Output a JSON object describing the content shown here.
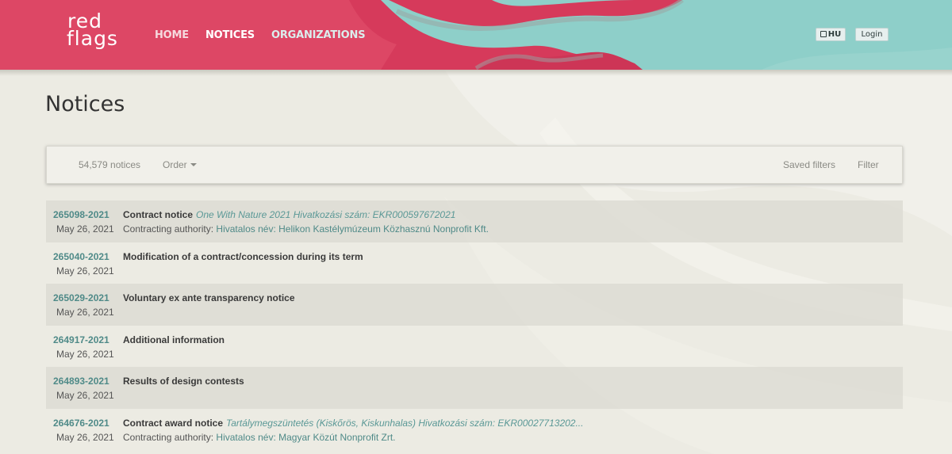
{
  "header": {
    "logo": {
      "line1": "red",
      "line2": "flags"
    },
    "nav": [
      {
        "label": "HOME"
      },
      {
        "label": "NOTICES"
      },
      {
        "label": "ORGANIZATIONS"
      }
    ],
    "language_button": "HU",
    "login_button": "Login",
    "colors": {
      "red": "#d8385a",
      "teal": "#8cd0ca"
    }
  },
  "page": {
    "title": "Notices"
  },
  "toolbar": {
    "count": "54,579 notices",
    "order": "Order",
    "saved_filters": "Saved filters",
    "filter": "Filter"
  },
  "notices": [
    {
      "id": "265098-2021",
      "date": "May 26, 2021",
      "type": "Contract notice",
      "subject": "One With Nature 2021 Hivatkozási szám: EKR000597672021",
      "authority_label": "Contracting authority:",
      "authority": "Hivatalos név: Helikon Kastélymúzeum Közhasznú Nonprofit Kft."
    },
    {
      "id": "265040-2021",
      "date": "May 26, 2021",
      "type": "Modification of a contract/concession during its term"
    },
    {
      "id": "265029-2021",
      "date": "May 26, 2021",
      "type": "Voluntary ex ante transparency notice"
    },
    {
      "id": "264917-2021",
      "date": "May 26, 2021",
      "type": "Additional information"
    },
    {
      "id": "264893-2021",
      "date": "May 26, 2021",
      "type": "Results of design contests"
    },
    {
      "id": "264676-2021",
      "date": "May 26, 2021",
      "type": "Contract award notice",
      "subject": "Tartálymegszüntetés (Kiskőrös, Kiskunhalas) Hivatkozási szám: EKR00027713202...",
      "authority_label": "Contracting authority:",
      "authority": "Hivatalos név: Magyar Közút Nonprofit Zrt."
    }
  ]
}
